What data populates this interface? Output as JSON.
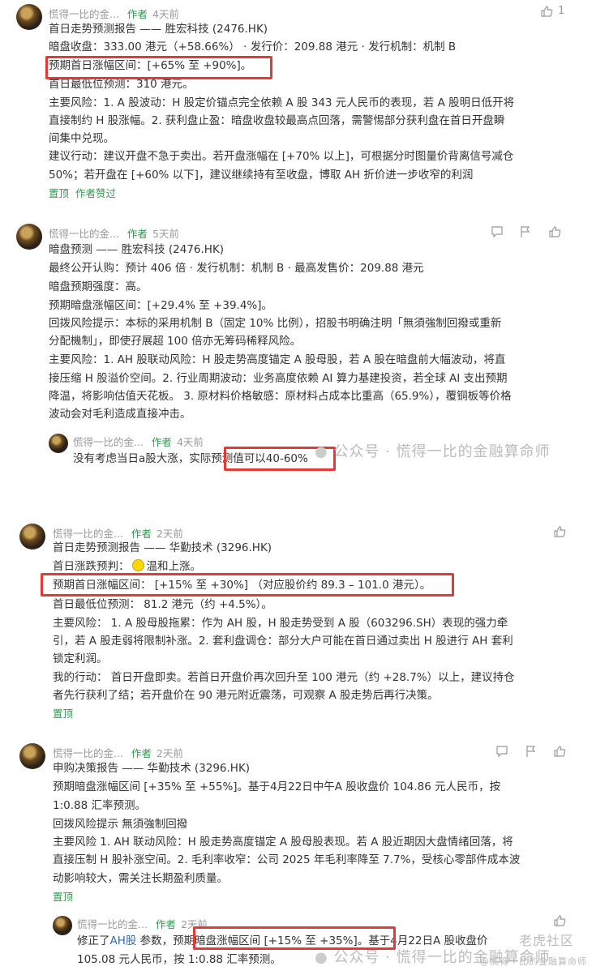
{
  "posts": [
    {
      "author": "慌得一比的金...",
      "author_tag": "作者",
      "time": "4天前",
      "like_count": "1",
      "lines": [
        "首日走势预测报告 —— 胜宏科技 (2476.HK)",
        "暗盘收盘：333.00 港元（+58.66%） · 发行价：209.88 港元 · 发行机制：机制 B",
        "预期首日涨幅区间：[+65% 至 +90%]。",
        "首日最低位预测：310 港元。",
        "主要风险：1. A 股波动：H 股定价锚点完全依赖 A 股 343 元人民币的表现，若 A 股明日低开将",
        "直接制约 H 股涨幅。2. 获利盘止盈：暗盘收盘较最高点回落，需警惕部分获利盘在首日开盘瞬",
        "间集中兑现。",
        "建议行动：建议开盘不急于卖出。若开盘涨幅在 [+70% 以上]，可根据分时图量价背离信号减仓",
        "50%；若开盘在 [+60% 以下]，建议继续持有至收盘，博取 AH 折价进一步收窄的利润"
      ],
      "footer": [
        "置顶",
        "作者赞过"
      ]
    },
    {
      "author": "慌得一比的金...",
      "author_tag": "作者",
      "time": "5天前",
      "lines": [
        "暗盘预测 —— 胜宏科技 (2476.HK)",
        "最终公开认购：预计 406 倍 · 发行机制：机制 B · 最高发售价：209.88 港元",
        "暗盘预期强度：高。",
        "预期暗盘涨幅区间：[+29.4% 至 +39.4%]。",
        "回拨风险提示：本标的采用机制 B（固定 10% 比例），招股书明确注明「無須強制回撥或重新",
        "分配機制」，即使孖展超 100 倍亦无筹码稀释风险。",
        "主要风险：1. AH 股联动风险：H 股走势高度锚定 A 股母股，若 A 股在暗盘前大幅波动，将直",
        "接压缩 H 股溢价空间。2. 行业周期波动：业务高度依赖 AI 算力基建投资，若全球 AI 支出预期",
        "降温，将影响估值天花板。 3. 原材料价格敏感：原材料占成本比重高（65.9%），覆铜板等价格",
        "波动会对毛利造成直接冲击。"
      ],
      "reply": {
        "author": "慌得一比的金...",
        "author_tag": "作者",
        "time": "4天前",
        "text": "没有考虑当日a股大涨，实际预测值可以40-60%"
      }
    },
    {
      "author": "慌得一比的金...",
      "author_tag": "作者",
      "time": "2天前",
      "lines": [
        "首日走势预测报告 —— 华勤技术 (3296.HK)",
        "首日涨跌预判：",
        "预期首日涨幅区间：  [+15% 至 +30%]  （对应股价约 89.3 – 101.0 港元）。",
        "首日最低位预测：  81.2 港元（约 +4.5%）。",
        "主要风险：  1. A 股母股拖累：作为 AH 股，H 股走势受到 A 股（603296.SH）表现的强力牵",
        "引，若 A 股走弱将限制补涨。2. 套利盘调仓：部分大户可能在首日通过卖出 H 股进行 AH 套利",
        "锁定利润。",
        "我的行动：  首日开盘即卖。若首日开盘价再次回升至 100 港元（约 +28.7%）以上，建议持仓",
        "者先行获利了结；若开盘价在 90 港元附近震荡，可观察 A 股走势后再行决策。"
      ],
      "mood": "温和上涨。",
      "footer": [
        "置顶"
      ]
    },
    {
      "author": "慌得一比的金...",
      "author_tag": "作者",
      "time": "2天前",
      "lines": [
        "申购决策报告 —— 华勤技术 (3296.HK)",
        "预期暗盘涨幅区间 [+35% 至 +55%]。基于4月22日中午A 股收盘价 104.86 元人民币，按",
        "1:0.88 汇率预测。",
        "回拨风险提示 無須強制回撥",
        "主要风险 1. AH 联动风险：H 股走势高度锚定 A 股母股表现。若 A 股近期因大盘情绪回落，将",
        "直接压制 H 股补涨空间。2. 毛利率收窄：公司 2025 年毛利率降至 7.7%，受核心零部件成本波",
        "动影响较大，需关注长期盈利质量。"
      ],
      "footer": [
        "置顶"
      ],
      "reply": {
        "author": "慌得一比的金...",
        "author_tag": "作者",
        "time": "2天前",
        "text_prefix": "修正了",
        "text_link": "AH股",
        "text_rest": " 参数，预期暗盘涨幅区间 [+15% 至 +35%]。基于4月22日A 股收盘价",
        "text_line2": "105.08 元人民币，按 1:0.88 汇率预测。"
      }
    }
  ],
  "watermarks": {
    "wechat": "公众号 · 慌得一比的金融算命师",
    "tiger": "老虎社区",
    "tiger_sub": "@慌得一比的金融算命师"
  },
  "colors": {
    "green": "#2e9a4d",
    "highlight_box": "#e53935",
    "text": "#333333",
    "meta": "#999999"
  }
}
